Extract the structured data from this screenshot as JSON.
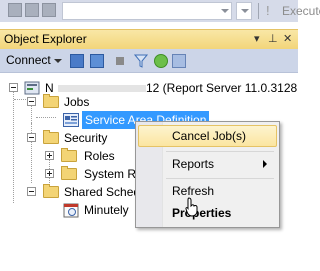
{
  "toolbar": {
    "execute_label": "Execute"
  },
  "object_explorer": {
    "title": "Object Explorer",
    "pin_glyph": "▾ ⊥ ✕",
    "connect_label": "Connect"
  },
  "tree": {
    "server_prefix": "N",
    "server_suffix": "12 (Report Server 11.0.3128",
    "jobs": "Jobs",
    "selected_job": "Service Area Definition",
    "security": "Security",
    "roles": "Roles",
    "system_roles": "System Ro",
    "shared_schedules": "Shared Sched",
    "minutely": "Minutely"
  },
  "context_menu": {
    "cancel_jobs": "Cancel Job(s)",
    "reports": "Reports",
    "refresh": "Refresh",
    "properties": "Properties"
  },
  "colors": {
    "selection": "#3399ff",
    "title_bar": "#f2d57a",
    "highlight": "#fbe5a0"
  }
}
